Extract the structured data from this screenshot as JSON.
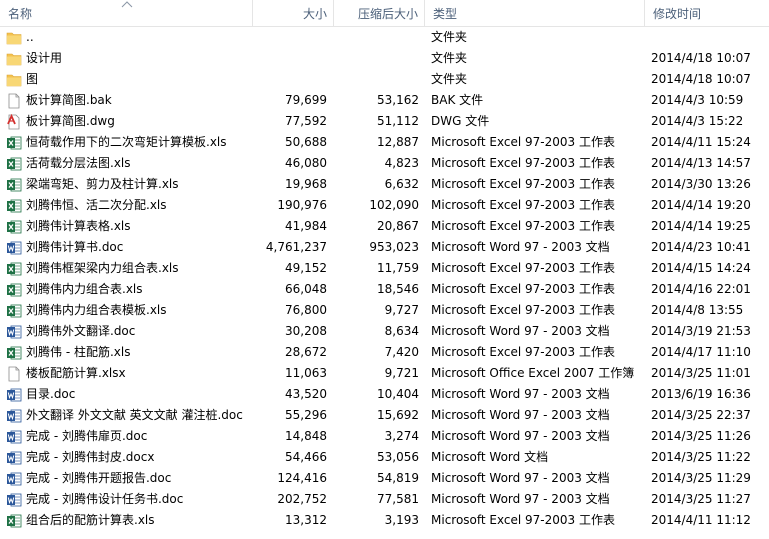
{
  "columns": {
    "name": "名称",
    "size": "大小",
    "compressed": "压缩后大小",
    "type": "类型",
    "modified": "修改时间"
  },
  "files": [
    {
      "name": "..",
      "size": "",
      "compressed": "",
      "type": "文件夹",
      "modified": "",
      "icon": "folder-icon"
    },
    {
      "name": "设计用",
      "size": "",
      "compressed": "",
      "type": "文件夹",
      "modified": "2014/4/18 10:07",
      "icon": "folder-icon"
    },
    {
      "name": "图",
      "size": "",
      "compressed": "",
      "type": "文件夹",
      "modified": "2014/4/18 10:07",
      "icon": "folder-icon"
    },
    {
      "name": "板计算简图.bak",
      "size": "79,699",
      "compressed": "53,162",
      "type": "BAK 文件",
      "modified": "2014/4/3 10:59",
      "icon": "blank-file-icon"
    },
    {
      "name": "板计算简图.dwg",
      "size": "77,592",
      "compressed": "51,112",
      "type": "DWG 文件",
      "modified": "2014/4/3 15:22",
      "icon": "dwg-file-icon"
    },
    {
      "name": "恒荷载作用下的二次弯矩计算模板.xls",
      "size": "50,688",
      "compressed": "12,887",
      "type": "Microsoft Excel 97-2003 工作表",
      "modified": "2014/4/11 15:24",
      "icon": "excel-file-icon"
    },
    {
      "name": "活荷载分层法图.xls",
      "size": "46,080",
      "compressed": "4,823",
      "type": "Microsoft Excel 97-2003 工作表",
      "modified": "2014/4/13 14:57",
      "icon": "excel-file-icon"
    },
    {
      "name": "梁端弯矩、剪力及柱计算.xls",
      "size": "19,968",
      "compressed": "6,632",
      "type": "Microsoft Excel 97-2003 工作表",
      "modified": "2014/3/30 13:26",
      "icon": "excel-file-icon"
    },
    {
      "name": "刘腾伟恒、活二次分配.xls",
      "size": "190,976",
      "compressed": "102,090",
      "type": "Microsoft Excel 97-2003 工作表",
      "modified": "2014/4/14 19:20",
      "icon": "excel-file-icon"
    },
    {
      "name": "刘腾伟计算表格.xls",
      "size": "41,984",
      "compressed": "20,867",
      "type": "Microsoft Excel 97-2003 工作表",
      "modified": "2014/4/14 19:25",
      "icon": "excel-file-icon"
    },
    {
      "name": "刘腾伟计算书.doc",
      "size": "4,761,237",
      "compressed": "953,023",
      "type": "Microsoft Word 97 - 2003 文档",
      "modified": "2014/4/23 10:41",
      "icon": "word-file-icon"
    },
    {
      "name": "刘腾伟框架梁内力组合表.xls",
      "size": "49,152",
      "compressed": "11,759",
      "type": "Microsoft Excel 97-2003 工作表",
      "modified": "2014/4/15 14:24",
      "icon": "excel-file-icon"
    },
    {
      "name": "刘腾伟内力组合表.xls",
      "size": "66,048",
      "compressed": "18,546",
      "type": "Microsoft Excel 97-2003 工作表",
      "modified": "2014/4/16 22:01",
      "icon": "excel-file-icon"
    },
    {
      "name": "刘腾伟内力组合表模板.xls",
      "size": "76,800",
      "compressed": "9,727",
      "type": "Microsoft Excel 97-2003 工作表",
      "modified": "2014/4/8 13:55",
      "icon": "excel-file-icon"
    },
    {
      "name": "刘腾伟外文翻译.doc",
      "size": "30,208",
      "compressed": "8,634",
      "type": "Microsoft Word 97 - 2003 文档",
      "modified": "2014/3/19 21:53",
      "icon": "word-file-icon"
    },
    {
      "name": "刘腾伟 - 柱配筋.xls",
      "size": "28,672",
      "compressed": "7,420",
      "type": "Microsoft Excel 97-2003 工作表",
      "modified": "2014/4/17 11:10",
      "icon": "excel-file-icon"
    },
    {
      "name": "楼板配筋计算.xlsx",
      "size": "11,063",
      "compressed": "9,721",
      "type": "Microsoft Office Excel 2007 工作簿",
      "modified": "2014/3/25 11:01",
      "icon": "blank-file-icon"
    },
    {
      "name": "目录.doc",
      "size": "43,520",
      "compressed": "10,404",
      "type": "Microsoft Word 97 - 2003 文档",
      "modified": "2013/6/19 16:36",
      "icon": "word-file-icon"
    },
    {
      "name": "外文翻译 外文文献 英文文献 灌注桩.doc",
      "size": "55,296",
      "compressed": "15,692",
      "type": "Microsoft Word 97 - 2003 文档",
      "modified": "2014/3/25 22:37",
      "icon": "word-file-icon"
    },
    {
      "name": "完成 - 刘腾伟扉页.doc",
      "size": "14,848",
      "compressed": "3,274",
      "type": "Microsoft Word 97 - 2003 文档",
      "modified": "2014/3/25 11:26",
      "icon": "word-file-icon"
    },
    {
      "name": "完成 - 刘腾伟封皮.docx",
      "size": "54,466",
      "compressed": "53,056",
      "type": "Microsoft Word 文档",
      "modified": "2014/3/25 11:22",
      "icon": "word-file-icon"
    },
    {
      "name": "完成 - 刘腾伟开题报告.doc",
      "size": "124,416",
      "compressed": "54,819",
      "type": "Microsoft Word 97 - 2003 文档",
      "modified": "2014/3/25 11:29",
      "icon": "word-file-icon"
    },
    {
      "name": "完成 - 刘腾伟设计任务书.doc",
      "size": "202,752",
      "compressed": "77,581",
      "type": "Microsoft Word 97 - 2003 文档",
      "modified": "2014/3/25 11:27",
      "icon": "word-file-icon"
    },
    {
      "name": "组合后的配筋计算表.xls",
      "size": "13,312",
      "compressed": "3,193",
      "type": "Microsoft Excel 97-2003 工作表",
      "modified": "2014/4/11 11:12",
      "icon": "excel-file-icon"
    }
  ],
  "colors": {
    "header_text": "#4c607a",
    "folder": "#f4c24f",
    "excel": "#1e7145",
    "word": "#2b579a",
    "dwg": "#d3312f"
  }
}
